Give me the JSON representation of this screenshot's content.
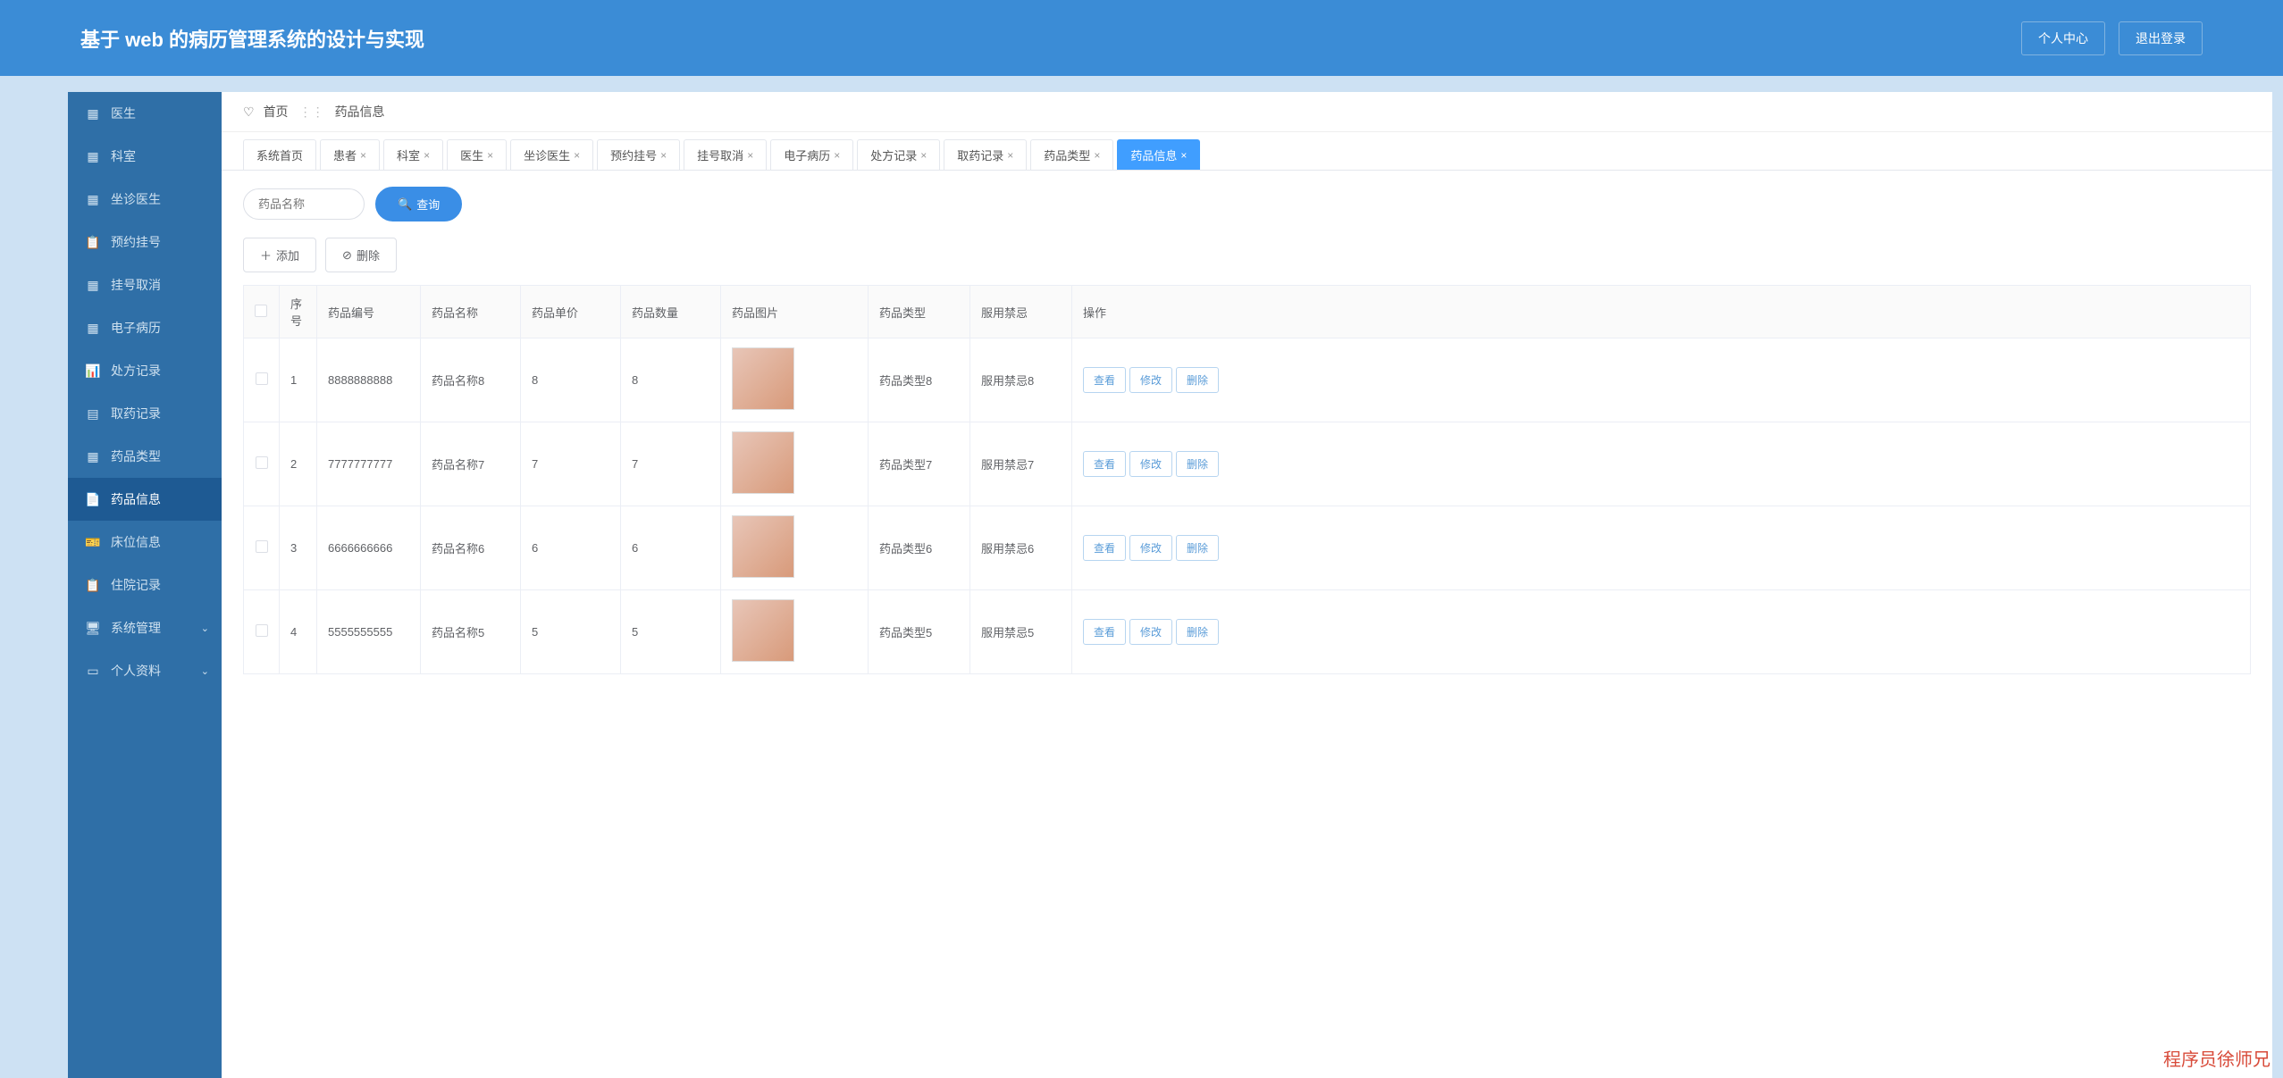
{
  "header": {
    "title": "基于 web 的病历管理系统的设计与实现",
    "profile": "个人中心",
    "logout": "退出登录"
  },
  "sidebar": {
    "items": [
      {
        "label": "医生",
        "icon": "grid"
      },
      {
        "label": "科室",
        "icon": "grid"
      },
      {
        "label": "坐诊医生",
        "icon": "grid"
      },
      {
        "label": "预约挂号",
        "icon": "clipboard"
      },
      {
        "label": "挂号取消",
        "icon": "grid"
      },
      {
        "label": "电子病历",
        "icon": "grid"
      },
      {
        "label": "处方记录",
        "icon": "bars"
      },
      {
        "label": "取药记录",
        "icon": "calendar"
      },
      {
        "label": "药品类型",
        "icon": "grid"
      },
      {
        "label": "药品信息",
        "icon": "file",
        "active": true
      },
      {
        "label": "床位信息",
        "icon": "ticket"
      },
      {
        "label": "住院记录",
        "icon": "clipboard"
      },
      {
        "label": "系统管理",
        "icon": "monitor",
        "expandable": true
      },
      {
        "label": "个人资料",
        "icon": "card",
        "expandable": true
      }
    ]
  },
  "breadcrumb": {
    "home": "首页",
    "current": "药品信息"
  },
  "tabs": [
    {
      "label": "系统首页",
      "closable": false
    },
    {
      "label": "患者",
      "closable": true
    },
    {
      "label": "科室",
      "closable": true
    },
    {
      "label": "医生",
      "closable": true
    },
    {
      "label": "坐诊医生",
      "closable": true
    },
    {
      "label": "预约挂号",
      "closable": true
    },
    {
      "label": "挂号取消",
      "closable": true
    },
    {
      "label": "电子病历",
      "closable": true
    },
    {
      "label": "处方记录",
      "closable": true
    },
    {
      "label": "取药记录",
      "closable": true
    },
    {
      "label": "药品类型",
      "closable": true
    },
    {
      "label": "药品信息",
      "closable": true,
      "active": true
    }
  ],
  "toolbar": {
    "search_placeholder": "药品名称",
    "search_btn": "查询",
    "add_btn": "添加",
    "delete_btn": "删除"
  },
  "table": {
    "headers": {
      "seq": "序号",
      "code": "药品编号",
      "name": "药品名称",
      "price": "药品单价",
      "qty": "药品数量",
      "img": "药品图片",
      "type": "药品类型",
      "taboo": "服用禁忌",
      "ops": "操作"
    },
    "ops": {
      "view": "查看",
      "edit": "修改",
      "del": "删除"
    },
    "rows": [
      {
        "seq": "1",
        "code": "8888888888",
        "name": "药品名称8",
        "price": "8",
        "qty": "8",
        "type": "药品类型8",
        "taboo": "服用禁忌8"
      },
      {
        "seq": "2",
        "code": "7777777777",
        "name": "药品名称7",
        "price": "7",
        "qty": "7",
        "type": "药品类型7",
        "taboo": "服用禁忌7"
      },
      {
        "seq": "3",
        "code": "6666666666",
        "name": "药品名称6",
        "price": "6",
        "qty": "6",
        "type": "药品类型6",
        "taboo": "服用禁忌6"
      },
      {
        "seq": "4",
        "code": "5555555555",
        "name": "药品名称5",
        "price": "5",
        "qty": "5",
        "type": "药品类型5",
        "taboo": "服用禁忌5"
      }
    ]
  },
  "watermark": "程序员徐师兄"
}
